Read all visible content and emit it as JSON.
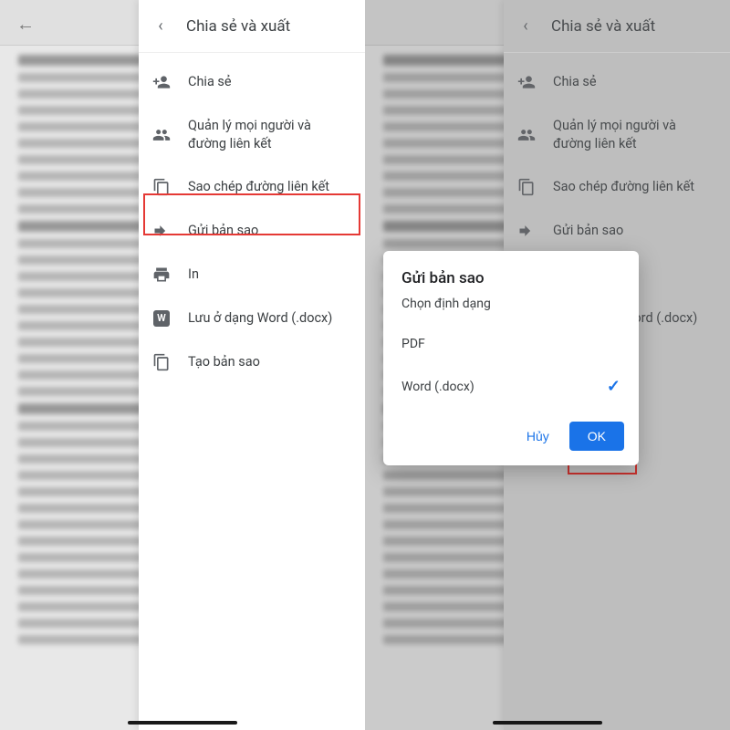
{
  "sheet": {
    "title": "Chia sẻ và xuất",
    "items": [
      {
        "label": "Chia sẻ",
        "icon": "person-add-icon"
      },
      {
        "label": "Quản lý mọi người và đường liên kết",
        "icon": "people-icon"
      },
      {
        "label": "Sao chép đường liên kết",
        "icon": "copy-link-icon"
      },
      {
        "label": "Gửi bản sao",
        "icon": "send-copy-icon"
      },
      {
        "label": "In",
        "icon": "print-icon"
      },
      {
        "label": "Lưu ở dạng Word (.docx)",
        "icon": "word-icon"
      },
      {
        "label": "Tạo bản sao",
        "icon": "make-copy-icon"
      }
    ]
  },
  "dialog": {
    "title": "Gửi bản sao",
    "subtitle": "Chọn định dạng",
    "options": {
      "pdf": "PDF",
      "word": "Word (.docx)"
    },
    "selected": "word",
    "cancel_label": "Hủy",
    "ok_label": "OK"
  }
}
